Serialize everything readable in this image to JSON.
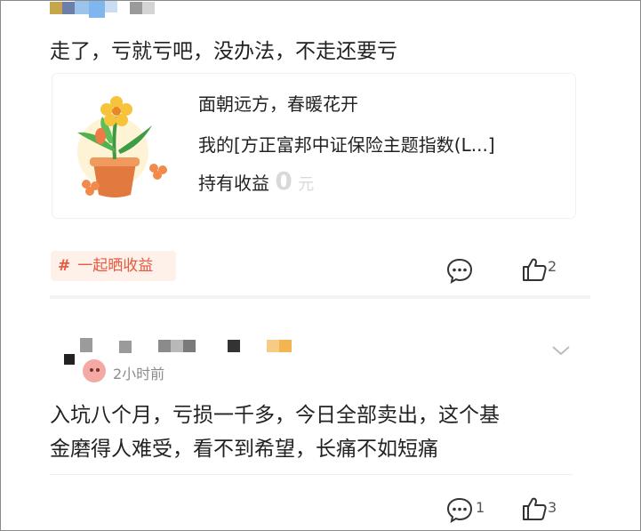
{
  "post1": {
    "content": "走了，亏就亏吧，没办法，不走还要亏",
    "card": {
      "line1": "面朝远方，春暖花开",
      "line2": "我的[方正富邦中证保险主题指数(L...]",
      "line3_prefix": "持有收益",
      "line3_value": "0",
      "line3_unit": "元"
    },
    "tag": {
      "hash": "#",
      "label": "一起晒收益"
    },
    "like_count": "2"
  },
  "post2": {
    "time": "2小时前",
    "content_line1": "入坑八个月，亏损一千多，今日全部卖出，这个基",
    "content_line2": "金磨得人难受，看不到希望，长痛不如短痛",
    "comment_count": "1",
    "like_count": "3"
  },
  "colors": {
    "tag_bg": "#fdf1ea",
    "tag_text": "#e9583f",
    "muted": "#d9d9d9"
  },
  "icons": [
    "comment-icon",
    "thumbs-up-icon",
    "chevron-down-icon",
    "flower-pot-image"
  ]
}
